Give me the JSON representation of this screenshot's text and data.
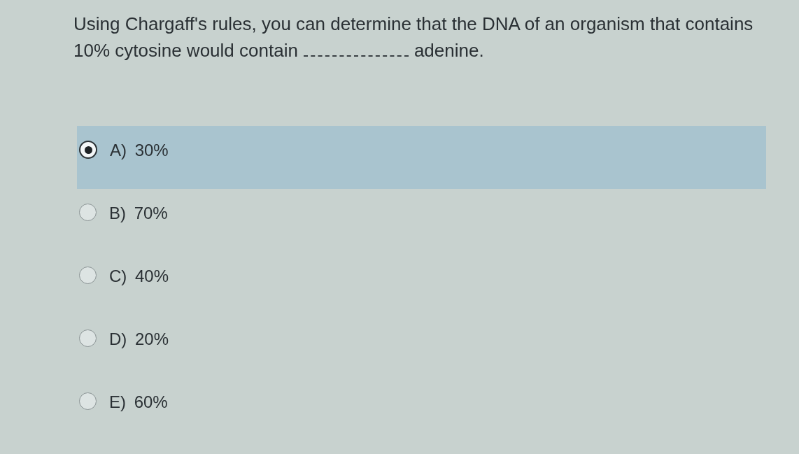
{
  "question": {
    "text_start": "Using Chargaff's rules, you can determine that the DNA of an organism that contains",
    "text_before_blank": "10% cytosine would contain",
    "text_after_blank": "adenine."
  },
  "options": [
    {
      "label": "A) 30%",
      "selected": true
    },
    {
      "label": "B) 70%",
      "selected": false
    },
    {
      "label": "C) 40%",
      "selected": false
    },
    {
      "label": "D) 20%",
      "selected": false
    },
    {
      "label": "E) 60%",
      "selected": false
    }
  ]
}
